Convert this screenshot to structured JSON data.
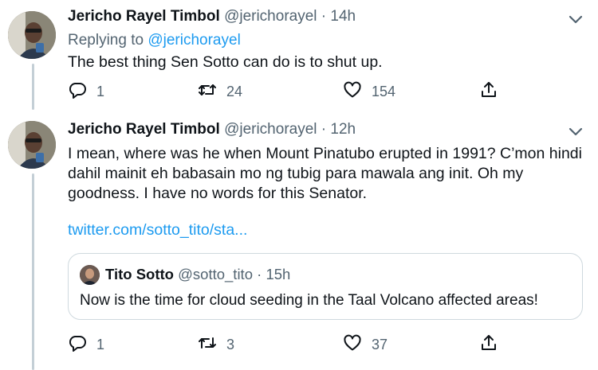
{
  "tweets": [
    {
      "name": "Jericho Rayel Timbol",
      "handle": "@jerichorayel",
      "separator": "·",
      "time": "14h",
      "replying_prefix": "Replying to",
      "replying_to": "@jerichorayel",
      "text": "The best thing Sen Sotto can do is to shut up.",
      "replies": "1",
      "retweets": "24",
      "likes": "154"
    },
    {
      "name": "Jericho Rayel Timbol",
      "handle": "@jerichorayel",
      "separator": "·",
      "time": "12h",
      "text_lines": [
        "I mean, where was he when Mount Pinatubo erupted in 1991? C’mon hindi",
        "dahil mainit eh babasain mo ng tubig para mawala ang init. Oh my",
        "goodness. I have no words for this Senator."
      ],
      "link": "twitter.com/sotto_tito/sta...",
      "quote": {
        "name": "Tito Sotto",
        "handle": "@sotto_tito",
        "separator": "·",
        "time": "15h",
        "text": "Now is the time for cloud seeding in the Taal Volcano affected areas!"
      },
      "replies": "1",
      "retweets": "3",
      "likes": "37"
    }
  ],
  "icons": {
    "reply": "speech-bubble-icon",
    "retweet": "retweet-arrows-icon",
    "like": "heart-icon",
    "share": "share-upload-icon",
    "more": "chevron-down-icon"
  },
  "colors": {
    "text": "#0f1419",
    "secondary": "#536471",
    "link": "#1d9bf0",
    "thread_line": "#c4cfd6",
    "border": "#cfd9de"
  }
}
